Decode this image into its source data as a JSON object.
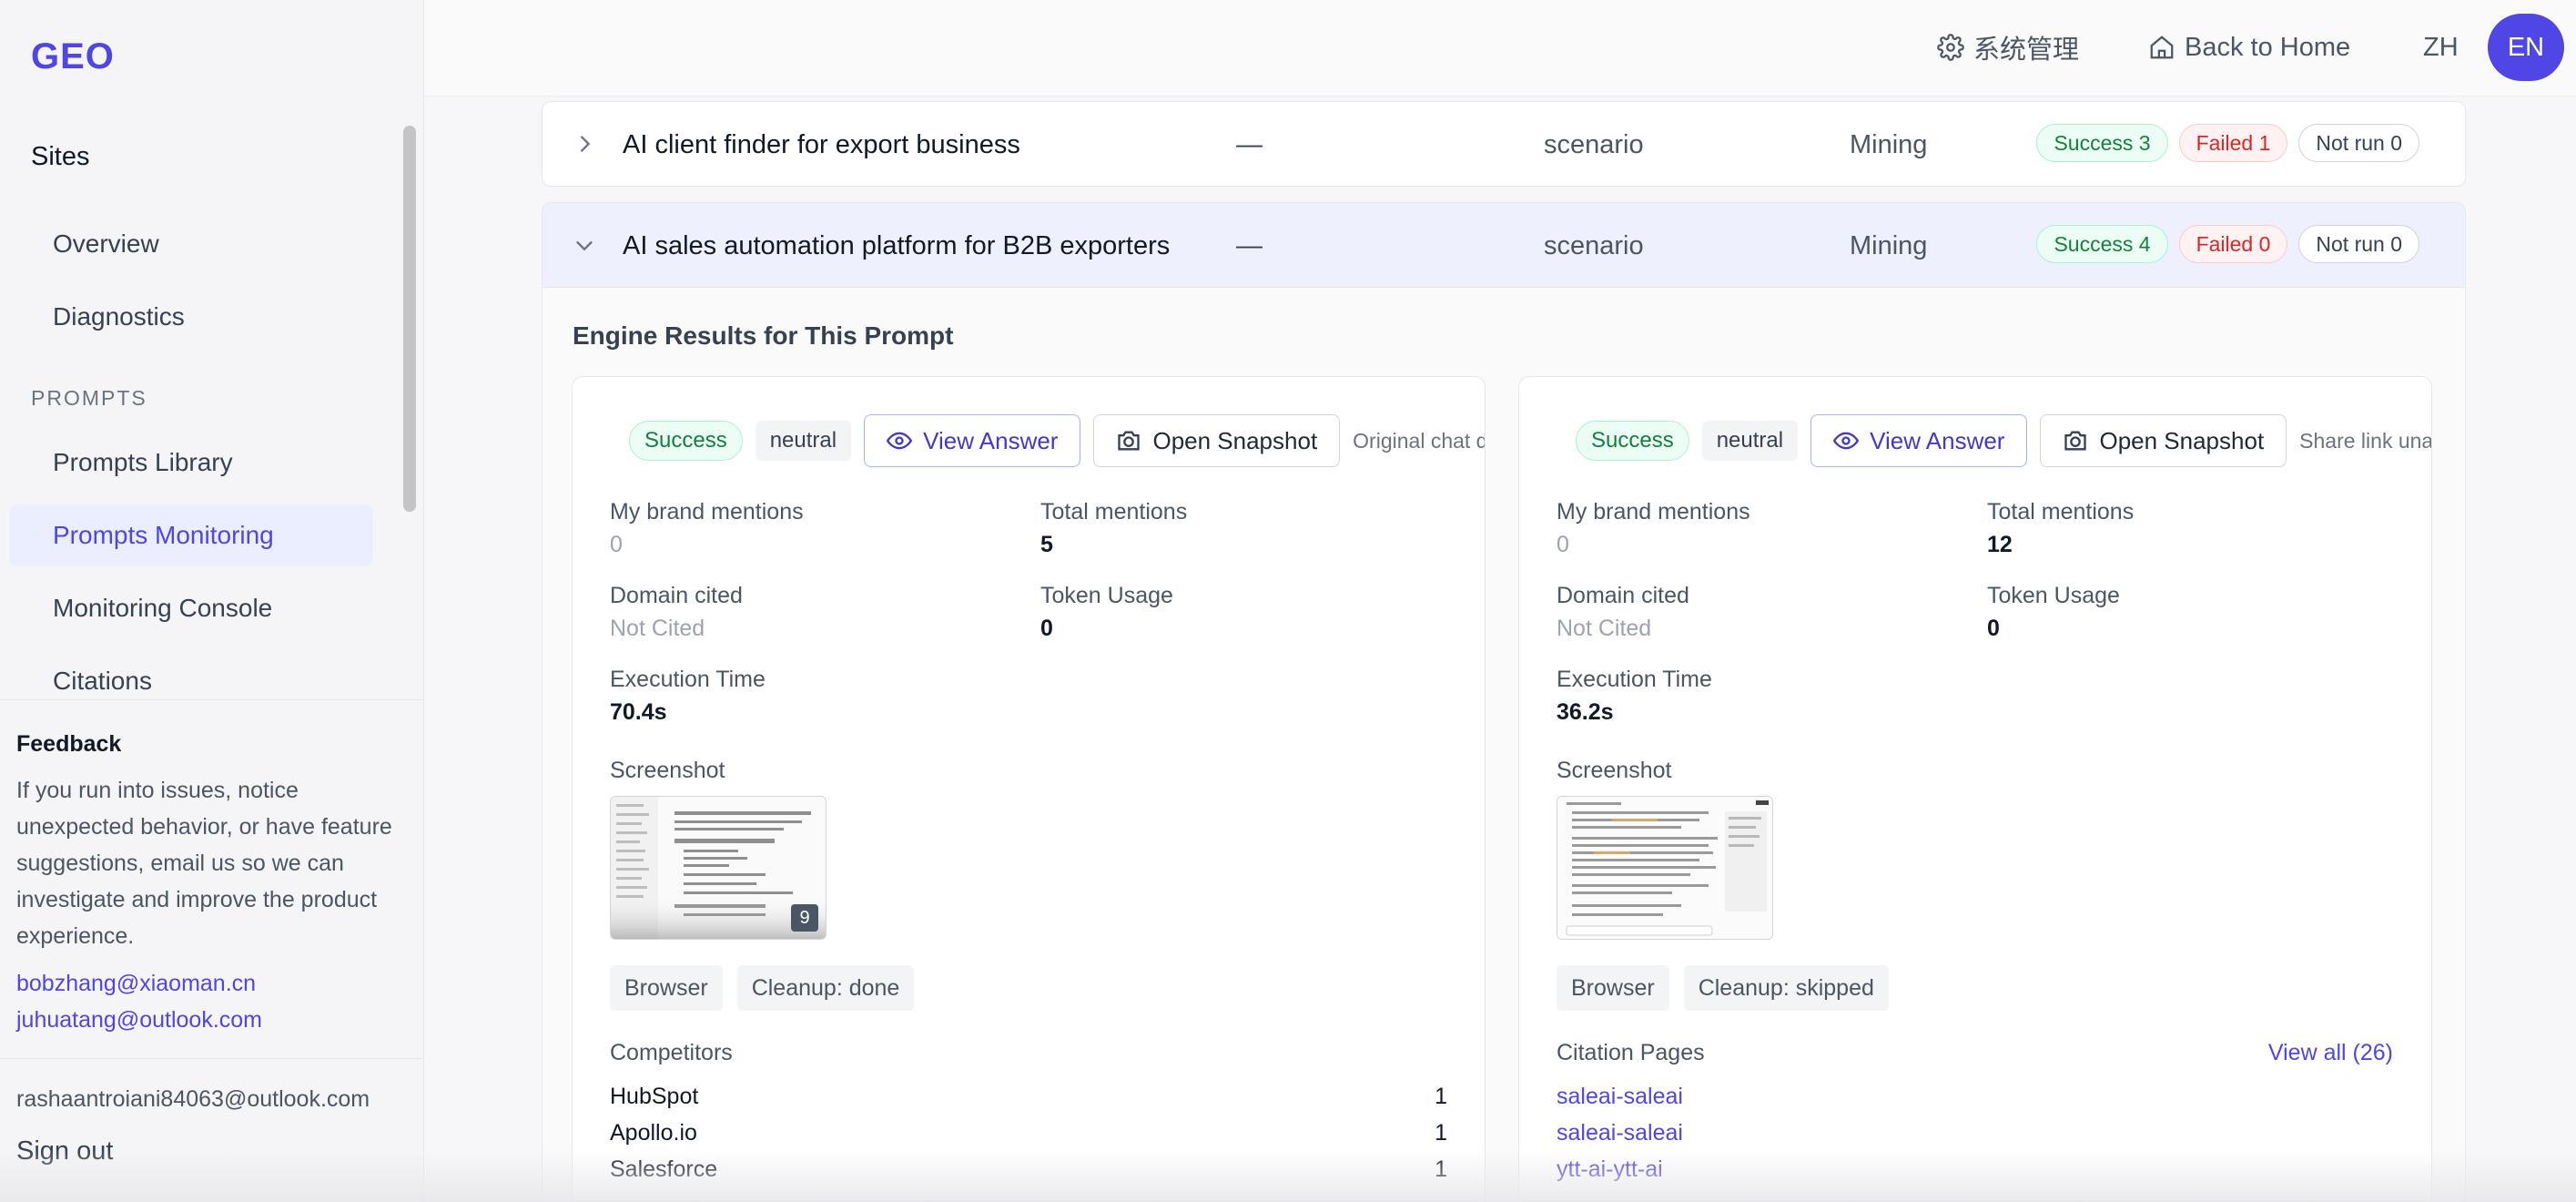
{
  "brand": {
    "logo": "GEO"
  },
  "sidebar": {
    "group_title": "Sites",
    "items_top": [
      {
        "label": "Overview"
      },
      {
        "label": "Diagnostics"
      }
    ],
    "section_label": "PROMPTS",
    "items_prompts": [
      {
        "label": "Prompts Library"
      },
      {
        "label": "Prompts Monitoring",
        "active": true
      },
      {
        "label": "Monitoring Console"
      },
      {
        "label": "Citations"
      }
    ],
    "feedback": {
      "title": "Feedback",
      "text": "If you run into issues, notice unexpected behavior, or have feature suggestions, email us so we can investigate and improve the product experience.",
      "emails": [
        "bobzhang@xiaoman.cn",
        "juhuatang@outlook.com"
      ]
    },
    "account": {
      "email": "rashaantroiani84063@outlook.com",
      "sign_out": "Sign out"
    }
  },
  "header": {
    "admin": "系统管理",
    "back_home": "Back to Home",
    "lang_zh": "ZH",
    "lang_en": "EN"
  },
  "prompts": [
    {
      "name": "AI client finder for export business",
      "dash": "—",
      "type": "scenario",
      "mode": "Mining",
      "success": "Success 3",
      "failed": "Failed 1",
      "not_run": "Not run 0",
      "expanded": false
    },
    {
      "name": "AI sales automation platform for B2B exporters",
      "dash": "—",
      "type": "scenario",
      "mode": "Mining",
      "success": "Success 4",
      "failed": "Failed 0",
      "not_run": "Not run 0",
      "expanded": true
    }
  ],
  "panel": {
    "title": "Engine Results for This Prompt",
    "labels": {
      "brand_mentions": "My brand mentions",
      "total_mentions": "Total mentions",
      "domain_cited": "Domain cited",
      "token_usage": "Token Usage",
      "execution_time": "Execution Time",
      "screenshot": "Screenshot",
      "view_answer": "View Answer",
      "open_snapshot": "Open Snapshot"
    },
    "cards": [
      {
        "status": "Success",
        "sentiment": "neutral",
        "note": "Original chat de",
        "brand_mentions": "0",
        "total_mentions": "5",
        "domain_cited": "Not Cited",
        "token_usage": "0",
        "execution_time": "70.4s",
        "screenshot_badge": "9",
        "chips": [
          "Browser",
          "Cleanup: done"
        ],
        "list_title": "Competitors",
        "competitors": [
          {
            "name": "HubSpot",
            "count": "1"
          },
          {
            "name": "Apollo.io",
            "count": "1"
          },
          {
            "name": "Salesforce",
            "count": "1"
          }
        ]
      },
      {
        "status": "Success",
        "sentiment": "neutral",
        "note": "Share link unav",
        "brand_mentions": "0",
        "total_mentions": "12",
        "domain_cited": "Not Cited",
        "token_usage": "0",
        "execution_time": "36.2s",
        "chips": [
          "Browser",
          "Cleanup: skipped"
        ],
        "list_title": "Citation Pages",
        "list_action": "View all (26)",
        "citations": [
          "saleai-saleai",
          "saleai-saleai",
          "ytt-ai-ytt-ai"
        ]
      }
    ]
  },
  "colors": {
    "accent": "#4f46e5",
    "success": "#15803d",
    "failed": "#dc2626"
  }
}
